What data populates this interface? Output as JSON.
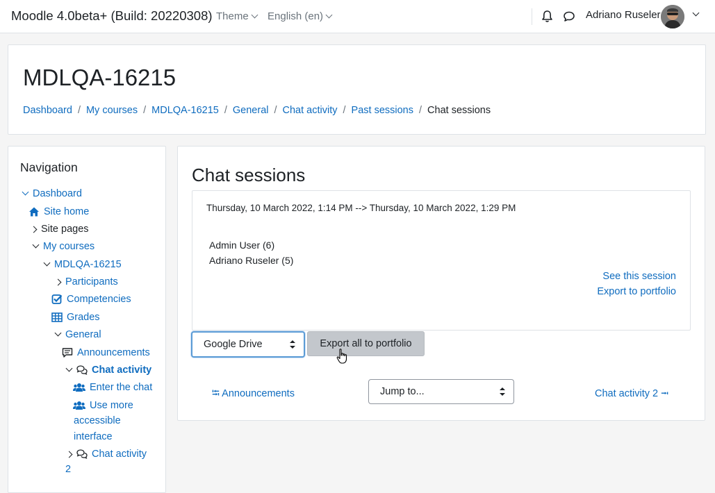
{
  "navbar": {
    "brand": "Moodle 4.0beta+ (Build: 20220308)",
    "theme_label": "Theme",
    "language_label": "English (en)",
    "user_name": "Adriano Ruseler"
  },
  "header": {
    "title": "MDLQA-16215",
    "breadcrumb": [
      "Dashboard",
      "My courses",
      "MDLQA-16215",
      "General",
      "Chat activity",
      "Past sessions",
      "Chat sessions"
    ]
  },
  "navigation": {
    "title": "Navigation",
    "items": {
      "dashboard": "Dashboard",
      "site_home": "Site home",
      "site_pages": "Site pages",
      "my_courses": "My courses",
      "course": "MDLQA-16215",
      "participants": "Participants",
      "competencies": "Competencies",
      "grades": "Grades",
      "general": "General",
      "announcements": "Announcements",
      "chat_activity": "Chat activity",
      "enter_chat": "Enter the chat",
      "accessible_1": "Use more",
      "accessible_2": "accessible",
      "accessible_3": "interface",
      "chat_activity_2a": "Chat activity",
      "chat_activity_2b": "2"
    }
  },
  "main": {
    "title": "Chat sessions",
    "session": {
      "range": "Thursday, 10 March 2022, 1:14 PM --> Thursday, 10 March 2022, 1:29 PM",
      "participants": [
        "Admin User (6)",
        "Adriano Ruseler (5)"
      ],
      "see_session": "See this session",
      "export_portfolio": "Export to portfolio"
    },
    "portfolio_select": "Google Drive",
    "export_all": "Export all to portfolio",
    "prev_activity": "Announcements",
    "jump_to": "Jump to...",
    "next_activity": "Chat activity 2"
  },
  "colors": {
    "link": "#0f6cbf",
    "text": "#1d2125",
    "muted": "#6a737b",
    "button_bg": "#c3c7cc"
  }
}
